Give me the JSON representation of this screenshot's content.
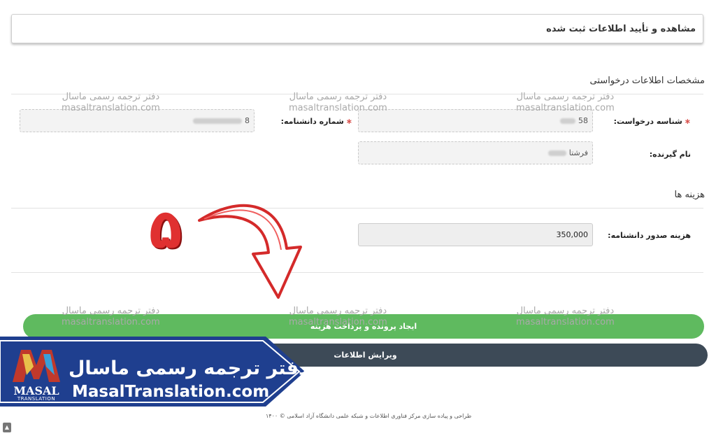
{
  "header": {
    "title": "مشاهده و تأیید اطلاعات ثبت شده"
  },
  "request_section": {
    "title": "مشخصات اطلاعات درخواستی",
    "request_id_label": "شناسه درخواست:",
    "request_id_value": "58",
    "recipient_label": "نام گیرنده:",
    "recipient_value": "فرشتا",
    "certificate_label": "شماره دانشنامه:",
    "certificate_value": "8"
  },
  "fees_section": {
    "title": "هزینه ها",
    "fee_label": "هزینه صدور دانشنامه:",
    "fee_value": "350,000"
  },
  "actions": {
    "create_pay": "ایجاد پرونده و پرداخت هزینه",
    "edit_info": "ویرایش اطلاعات"
  },
  "watermark": {
    "fa": "دفتر ترجمه رسمی ماسال",
    "en": "masaltranslation.com"
  },
  "annotation": {
    "step_number": "۵"
  },
  "brand": {
    "name_fa": "دفتر ترجمه رسمی ماسال",
    "site": "MasalTranslation.com",
    "logo_text": "MASAL",
    "logo_sub": "TRANSLATION"
  },
  "footer": {
    "text": "طراحی و پیاده سازی مرکز فناوری اطلاعات و شبکه علمی دانشگاه آزاد اسلامی © ۱۴۰۰"
  },
  "colors": {
    "green": "#5fba5f",
    "dark": "#3d4a57",
    "brand_blue": "#1f3f8f",
    "arrow_red": "#e03030"
  }
}
